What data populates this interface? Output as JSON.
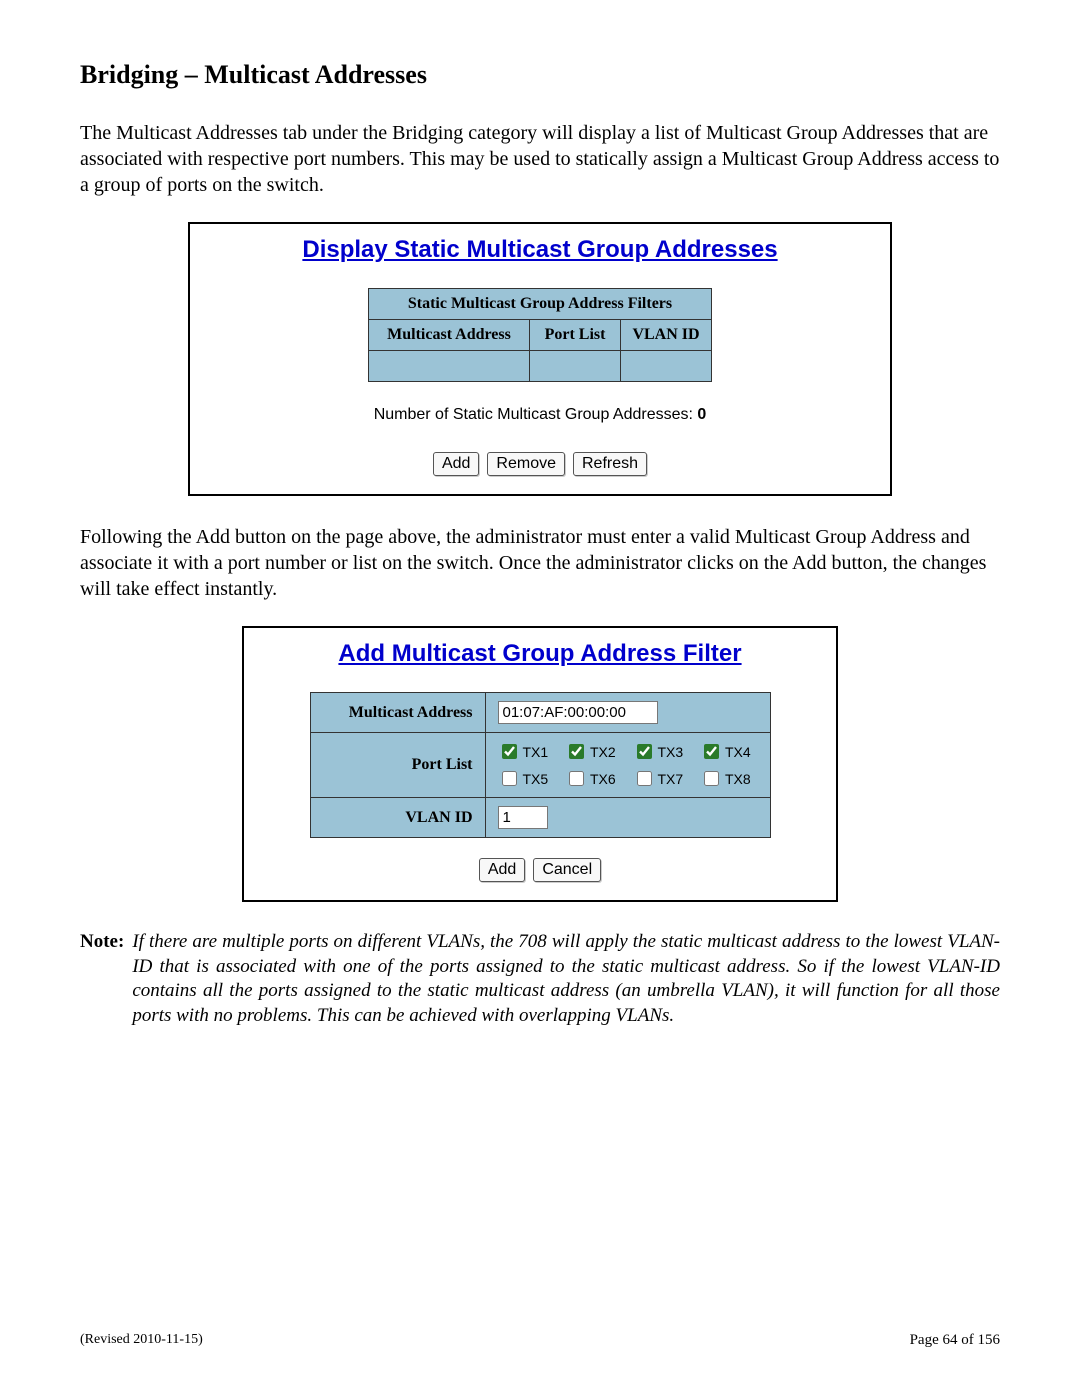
{
  "heading": "Bridging – Multicast Addresses",
  "intro_text": "The Multicast Addresses tab under the Bridging category will display a list of Multicast Group Addresses that are associated with respective port numbers.  This may be used to statically assign a Multicast Group Address access to a group of ports on the switch.",
  "panel1": {
    "title": "Display Static Multicast Group Addresses",
    "table_caption": "Static Multicast Group Address Filters",
    "col1": "Multicast Address",
    "col2": "Port List",
    "col3": "VLAN ID",
    "status_prefix": "Number of Static Multicast Group Addresses: ",
    "status_value": "0",
    "btn_add": "Add",
    "btn_remove": "Remove",
    "btn_refresh": "Refresh"
  },
  "mid_text": "Following the Add button on the page above, the administrator must enter a valid Multicast Group Address and associate it with a port number or list on the switch.  Once the administrator clicks on the Add button, the changes will take effect instantly.",
  "panel2": {
    "title": "Add Multicast Group Address Filter",
    "row1_label": "Multicast Address",
    "row1_value": "01:07:AF:00:00:00",
    "row2_label": "Port List",
    "ports": [
      {
        "name": "TX1",
        "checked": true
      },
      {
        "name": "TX2",
        "checked": true
      },
      {
        "name": "TX3",
        "checked": true
      },
      {
        "name": "TX4",
        "checked": true
      },
      {
        "name": "TX5",
        "checked": false
      },
      {
        "name": "TX6",
        "checked": false
      },
      {
        "name": "TX7",
        "checked": false
      },
      {
        "name": "TX8",
        "checked": false
      }
    ],
    "row3_label": "VLAN ID",
    "row3_value": "1",
    "btn_add": "Add",
    "btn_cancel": "Cancel"
  },
  "note_label": "Note:",
  "note_body": "If there are multiple ports on different VLANs, the 708 will apply the static multicast address to the lowest VLAN-ID that is associated with one of the ports assigned to the static multicast address.  So if the lowest VLAN-ID contains all the ports assigned to the static multicast address (an umbrella VLAN), it will function for all those ports with no problems.  This can be achieved with overlapping VLANs.",
  "footer_left": "(Revised 2010-11-15)",
  "footer_right": "Page 64 of 156"
}
